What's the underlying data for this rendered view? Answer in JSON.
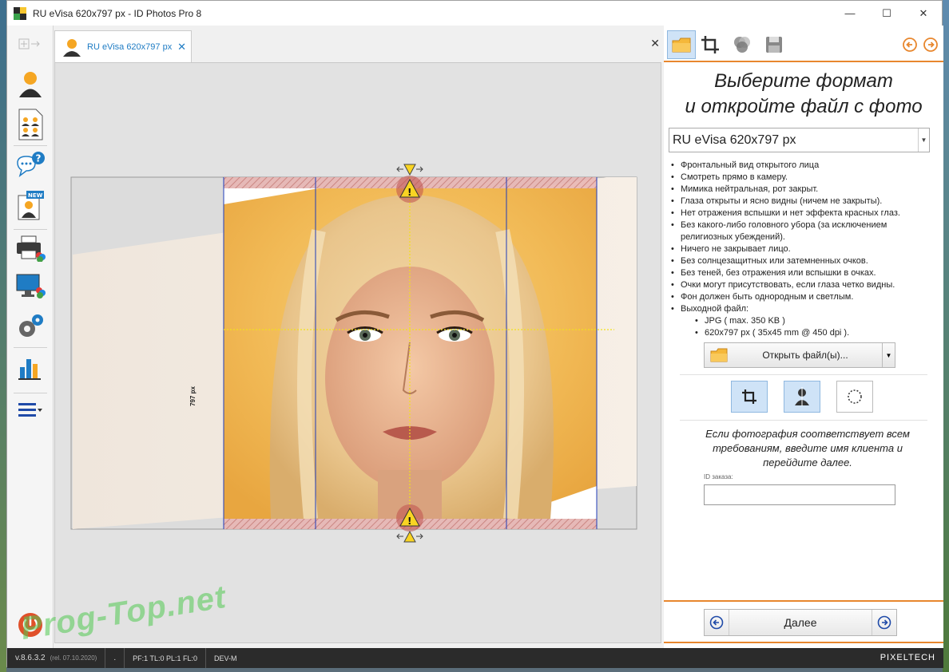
{
  "window": {
    "title": "RU eVisa 620x797 px - ID Photos Pro 8"
  },
  "tab": {
    "label": "RU eVisa 620x797 px"
  },
  "canvas": {
    "height_label": "797 px"
  },
  "right_panel": {
    "heading_line1": "Выберите формат",
    "heading_line2": "и откройте файл с фото",
    "format_selected": "RU eVisa 620x797 px",
    "requirements": [
      "Фронтальный вид открытого лица",
      "Смотреть прямо в камеру.",
      "Мимика нейтральная, рот закрыт.",
      "Глаза открыты и ясно видны (ничем не закрыты).",
      "Нет отражения вспышки и нет эффекта красных глаз.",
      "Без какого-либо головного убора (за исключением религиозных убеждений).",
      "Ничего не закрывает лицо.",
      "Без солнцезащитных или затемненных очков.",
      "Без теней, без отражения или вспышки в очках.",
      "Очки могут присутствовать, если глаза четко видны.",
      "Фон должен быть однородным и светлым.",
      "Выходной файл:"
    ],
    "output_specs": [
      "JPG  ( max. 350 KB )",
      "620x797 px  ( 35x45 mm @ 450 dpi )."
    ],
    "open_button": "Открыть файл(ы)...",
    "hint": "Если фотография соответствует всем требованиям, введите имя клиента и перейдите далее.",
    "order_id_label": "ID заказа:",
    "order_id_value": "",
    "next_button": "Далее"
  },
  "statusbar": {
    "version": "v.8.6.3.2",
    "release": "(rel. 07.10.2020)",
    "dot": ".",
    "flags": "PF:1 TL:0 PL:1 FL:0",
    "mode": "DEV-M",
    "brand": "PIXELTECH"
  },
  "watermark": "Prog-Top.net",
  "colors": {
    "accent": "#e8872e",
    "tab_text": "#1f7cc4",
    "guide_red": "#c0504d",
    "guide_blue": "#1f3cba",
    "guide_yellow": "#f2e21a"
  }
}
